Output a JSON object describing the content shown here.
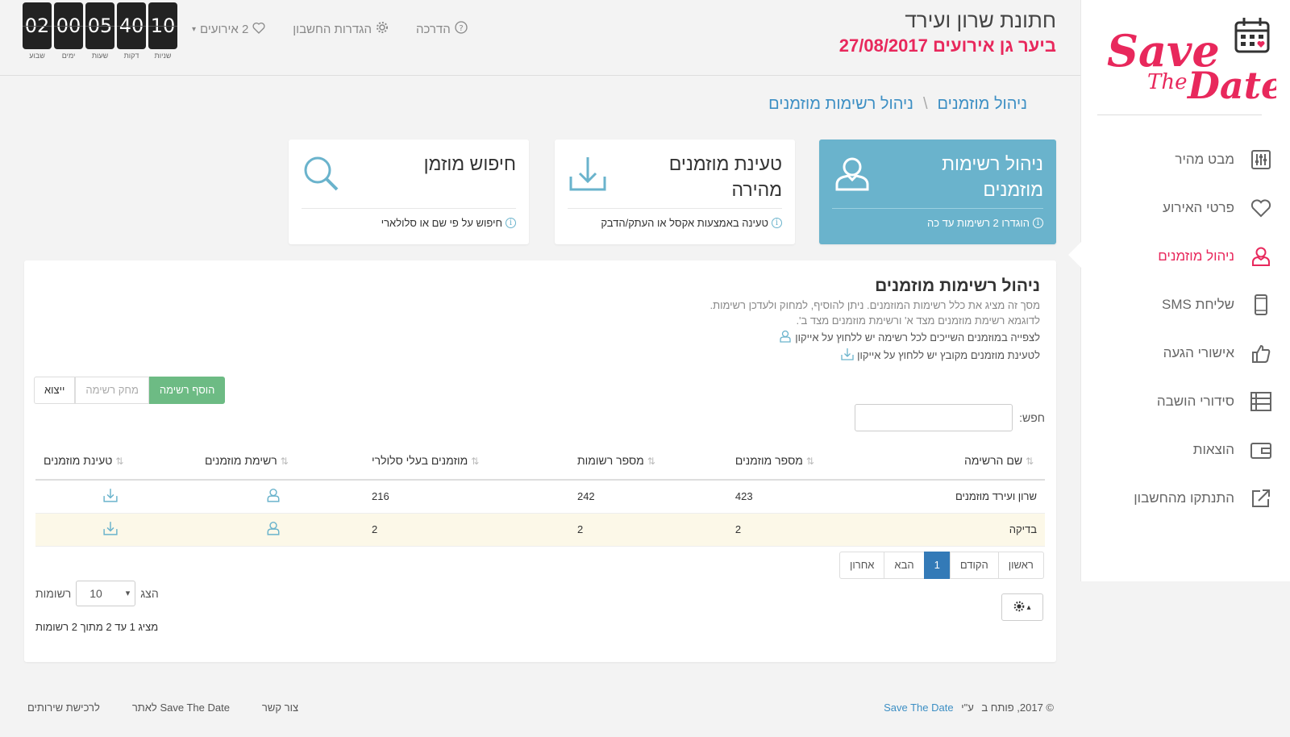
{
  "brand": {
    "logo_line1": "Save",
    "logo_line2": "The",
    "logo_line3": "Date",
    "color": "#e8285c"
  },
  "sidebar": {
    "items": [
      {
        "label": "מבט מהיר",
        "icon": "sliders-icon"
      },
      {
        "label": "פרטי האירוע",
        "icon": "heart-icon"
      },
      {
        "label": "ניהול מוזמנים",
        "icon": "user-icon",
        "active": true
      },
      {
        "label": "שליחת SMS",
        "icon": "phone-icon"
      },
      {
        "label": "אישורי הגעה",
        "icon": "thumbs-up-icon"
      },
      {
        "label": "סידורי הושבה",
        "icon": "list-icon"
      },
      {
        "label": "הוצאות",
        "icon": "wallet-icon"
      },
      {
        "label": "התנתקו מהחשבון",
        "icon": "logout-icon"
      }
    ]
  },
  "header": {
    "title": "חתונת שרון ועירד",
    "subtitle": "ביער גן אירועים 27/08/2017",
    "guide": "הדרכה",
    "settings": "הגדרות החשבון",
    "events": "2 אירועים"
  },
  "countdown": [
    {
      "value": "02",
      "label": "שבוע"
    },
    {
      "value": "00",
      "label": "ימים"
    },
    {
      "value": "05",
      "label": "שעות"
    },
    {
      "value": "40",
      "label": "דקות"
    },
    {
      "value": "10",
      "label": "שניות"
    }
  ],
  "breadcrumb": {
    "first": "ניהול מוזמנים",
    "sep": "\\",
    "second": "ניהול רשימות מוזמנים"
  },
  "cards": {
    "manage": {
      "title": "ניהול רשימות מוזמנים",
      "note": "הוגדרו 2 רשימות עד כה"
    },
    "upload": {
      "title": "טעינת מוזמנים מהירה",
      "note": "טעינה באמצעות אקסל או העתק/הדבק"
    },
    "search": {
      "title": "חיפוש מוזמן",
      "note": "חיפוש על פי שם או סלולארי"
    }
  },
  "panel": {
    "title": "ניהול רשימות מוזמנים",
    "desc1": "מסך זה מציג את כלל רשימות המוזמנים. ניתן להוסיף, למחוק ולעדכן רשימות.",
    "desc2": "לדוגמא רשימת מוזמנים מצד א' ורשימת מוזמנים מצד ב'.",
    "hint1": "לצפייה במוזמנים השייכים לכל רשימה יש ללחוץ על אייקון",
    "hint2": "לטעינת מוזמנים מקובץ יש ללחוץ על אייקון",
    "btn_add": "הוסף רשימה",
    "btn_delete": "מחק רשימה",
    "btn_export": "ייצוא",
    "search_label": "חפש:",
    "search_placeholder": ""
  },
  "table": {
    "columns": [
      "שם הרשימה",
      "מספר מוזמנים",
      "מספר רשומות",
      "מוזמנים בעלי סלולרי",
      "רשימת מוזמנים",
      "טעינת מוזמנים"
    ],
    "rows": [
      {
        "name": "שרון ועירד מוזמנים",
        "guests": "423",
        "records": "242",
        "mobile": "216"
      },
      {
        "name": "בדיקה",
        "guests": "2",
        "records": "2",
        "mobile": "2"
      }
    ]
  },
  "pager": {
    "first": "ראשון",
    "prev": "הקודם",
    "current": "1",
    "next": "הבא",
    "last": "אחרון"
  },
  "length": {
    "show": "הצג",
    "value": "10",
    "records": "רשומות"
  },
  "info": "מציג 1 עד 2 מתוך 2 רשומות",
  "footer": {
    "copy_prefix": "© 2017, פותח ב",
    "copy_mid": "ע\"י",
    "copy_brand": "Save The Date",
    "contact": "צור קשר",
    "site": "לאתר Save The Date",
    "buy": "לרכישת שירותים"
  },
  "colors": {
    "accent": "#e8285c",
    "blue": "#6ab3cc",
    "link": "#3d8fc4",
    "green": "#6dbb84"
  }
}
